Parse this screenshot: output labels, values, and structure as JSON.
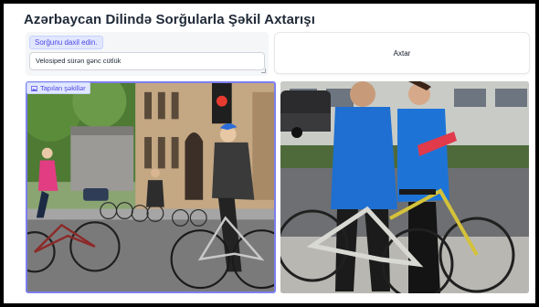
{
  "app": {
    "title": "Azərbaycan Dilində Sorğularla Şəkil Axtarışı"
  },
  "query": {
    "label": "Sorğunu daxil edin.",
    "value": "Velosiped sürən gənc cütlük"
  },
  "search": {
    "button_label": "Axtar"
  },
  "gallery": {
    "label": "Tapılan şəkillər",
    "icon": "image-gallery-icon",
    "items": [
      {
        "name": "result-image-1",
        "selected": true
      },
      {
        "name": "result-image-2",
        "selected": false
      }
    ]
  },
  "colors": {
    "accent": "#6366f1",
    "selected_border": "#7c7ef0",
    "label_bg": "#e0e7ff"
  }
}
